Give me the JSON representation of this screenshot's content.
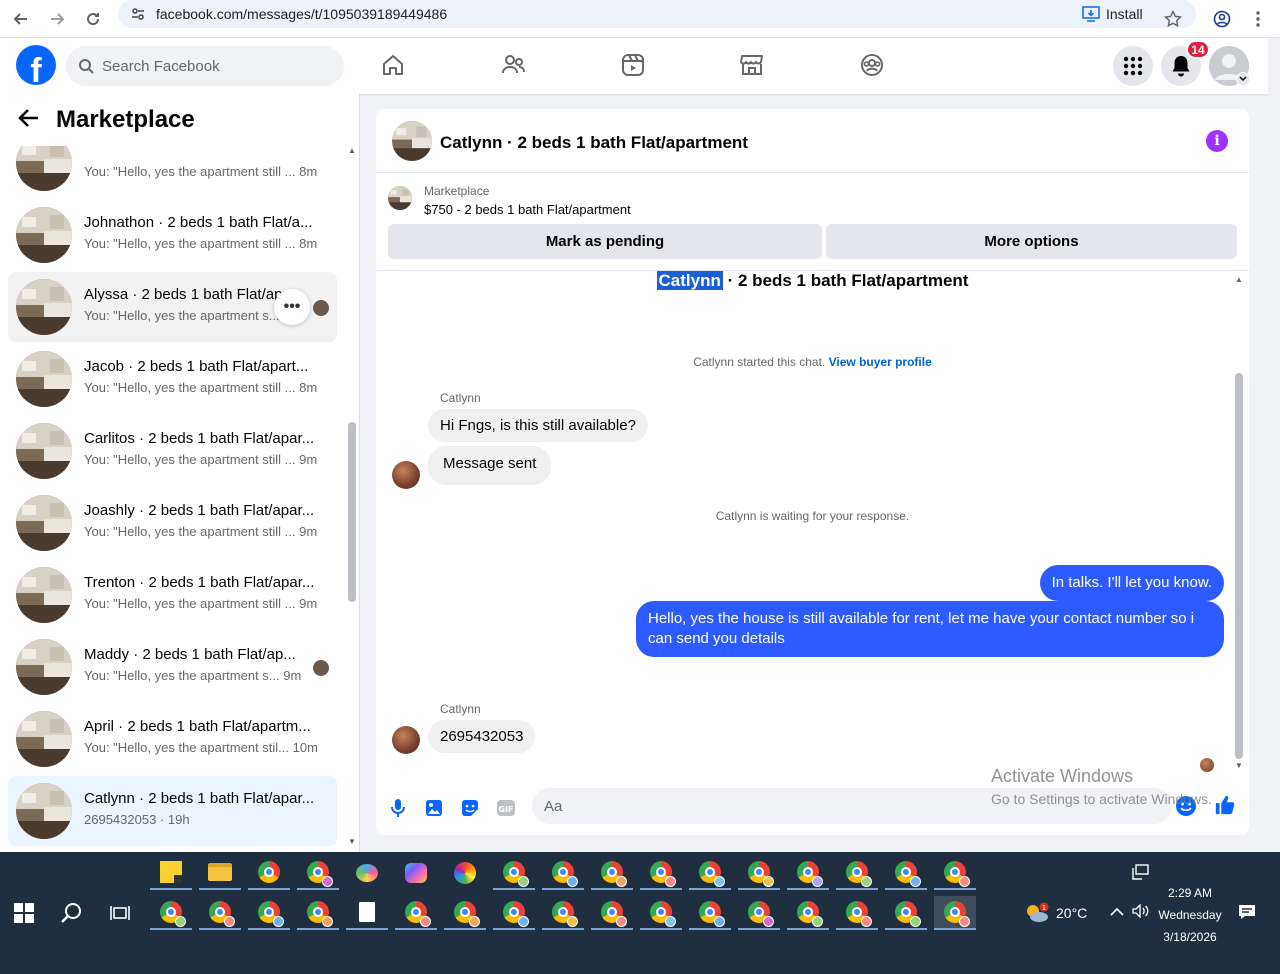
{
  "browser": {
    "url": "facebook.com/messages/t/1095039189449486",
    "install_label": "Install"
  },
  "fb_header": {
    "search_placeholder": "Search Facebook",
    "notification_count": "14"
  },
  "left_panel": {
    "title": "Marketplace",
    "conversations": [
      {
        "name": "",
        "preview": "You: \"Hello, yes the apartment still ... 8m"
      },
      {
        "name": "Johnathon · 2 beds 1 bath Flat/a...",
        "preview": "You: \"Hello, yes the apartment still ... 8m"
      },
      {
        "name": "Alyssa · 2 beds 1 bath Flat/ap",
        "preview": "You: \"Hello, yes the apartment s..."
      },
      {
        "name": "Jacob · 2 beds 1 bath Flat/apart...",
        "preview": "You: \"Hello, yes the apartment still ... 8m"
      },
      {
        "name": "Carlitos · 2 beds 1 bath Flat/apar...",
        "preview": "You: \"Hello, yes the apartment still ... 9m"
      },
      {
        "name": "Joashly · 2 beds 1 bath Flat/apar...",
        "preview": "You: \"Hello, yes the apartment still ... 9m"
      },
      {
        "name": "Trenton · 2 beds 1 bath Flat/apar...",
        "preview": "You: \"Hello, yes the apartment still ... 9m"
      },
      {
        "name": "Maddy · 2 beds 1 bath Flat/ap...",
        "preview": "You: \"Hello, yes the apartment s...  9m"
      },
      {
        "name": "April · 2 beds 1 bath Flat/apartm...",
        "preview": "You: \"Hello, yes the apartment stil... 10m"
      },
      {
        "name": "Catlynn · 2 beds 1 bath Flat/apar...",
        "preview": "2695432053 · 19h"
      }
    ]
  },
  "chat": {
    "title": "Catlynn · 2 beds 1 bath Flat/apartment",
    "listing_label": "Marketplace",
    "listing_price": "$750 - 2 beds 1 bath Flat/apartment",
    "mark_pending_label": "Mark as pending",
    "more_options_label": "More options",
    "thread_title_name": "Catlynn",
    "thread_title_rest": " · 2 beds 1 bath Flat/apartment",
    "started_note": "Catlynn started this chat.",
    "view_buyer_profile": "View buyer profile",
    "sender_name": "Catlynn",
    "msg_1": "Hi Fngs, is this still available?",
    "msg_2": "Message sent",
    "waiting_note": "Catlynn is waiting for your response.",
    "reply_1": "In talks. I'll let you know.",
    "reply_2": "Hello, yes the house is still available for rent, let me have your contact number so i can send you details",
    "msg_3": "2695432053",
    "composer_placeholder": "Aa"
  },
  "watermark": {
    "line1": "Activate Windows",
    "line2": "Go to Settings to activate Windows."
  },
  "taskbar": {
    "temperature": "20°C",
    "time": "2:29 AM",
    "day": "Wednesday",
    "date": "3/18/2026"
  },
  "colors": {
    "fb_blue": "#0866ff",
    "outgoing_bubble": "#2d5bff",
    "notification_red": "#e41e3f",
    "info_purple": "#a033ff"
  }
}
